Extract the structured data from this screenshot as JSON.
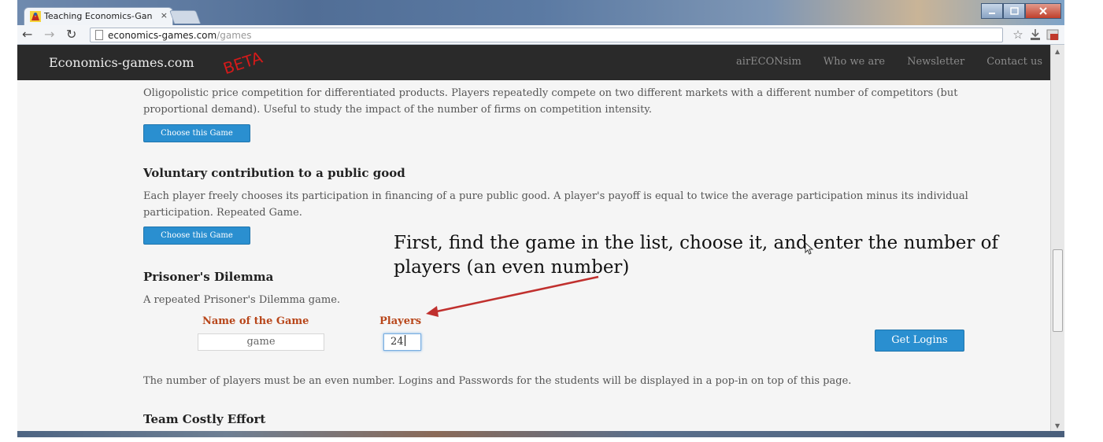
{
  "browser": {
    "tab_title": "Teaching Economics-Gan",
    "tab_close": "×",
    "url_host": "economics-games.com",
    "url_path": "/games"
  },
  "navbar": {
    "brand": "Economics-games.com",
    "beta": "BETA",
    "links": [
      "airECONsim",
      "Who we are",
      "Newsletter",
      "Contact us"
    ]
  },
  "games": {
    "oligopoly_description": "Oligopolistic price competition for differentiated products. Players repeatedly compete on two different markets with a different number of competitors (but proportional demand). Useful to study the impact of the number of firms on competition intensity.",
    "choose_label": "Choose this Game",
    "public_good_title": "Voluntary contribution to a public good",
    "public_good_description": "Each player freely chooses its participation in financing of a pure public good. A player's payoff is equal to twice the average participation minus its individual participation. Repeated Game.",
    "prisoners_title": "Prisoner's Dilemma",
    "prisoners_description": "A repeated Prisoner's Dilemma game.",
    "next_title": "Team Costly Effort"
  },
  "form": {
    "name_label": "Name of the Game",
    "players_label": "Players",
    "name_value": "game",
    "players_value": "24",
    "get_logins": "Get Logins",
    "note": "The number of players must be an even number. Logins and Passwords for the students will be displayed in a pop-in on top of this page."
  },
  "annotation": {
    "text": "First, find the game in the list, choose it, and enter the number of players (an even number)",
    "color": "#c0302e"
  },
  "colors": {
    "navbar": "#2a2a2a",
    "button": "#2a8fd0",
    "form_label": "#b8461a"
  }
}
